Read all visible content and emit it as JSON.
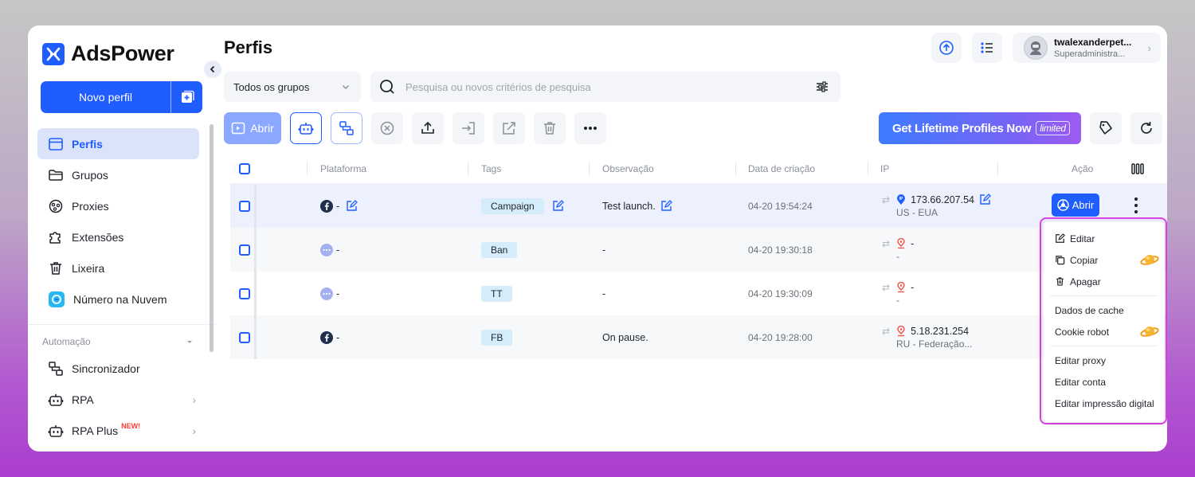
{
  "brand": {
    "name": "AdsPower",
    "color": "#1f5dff"
  },
  "sidebar": {
    "new_profile_label": "Novo perfil",
    "items": [
      {
        "label": "Perfis",
        "icon": "browser-window-icon",
        "active": true
      },
      {
        "label": "Grupos",
        "icon": "folder-icon",
        "active": false
      },
      {
        "label": "Proxies",
        "icon": "network-icon",
        "active": false
      },
      {
        "label": "Extensões",
        "icon": "puzzle-icon",
        "active": false
      },
      {
        "label": "Lixeira",
        "icon": "trash-icon",
        "active": false
      },
      {
        "label": "Número na Nuvem",
        "icon": "cloud-number-icon",
        "active": false
      }
    ],
    "automation_header": "Automação",
    "automation_items": [
      {
        "label": "Sincronizador",
        "icon": "sync-icon"
      },
      {
        "label": "RPA",
        "icon": "robot-icon"
      },
      {
        "label": "RPA Plus",
        "icon": "robot-icon",
        "badge": "NEW!"
      }
    ]
  },
  "header": {
    "title": "Perfis",
    "user": {
      "name": "twalexanderpet...",
      "role": "Superadministra..."
    }
  },
  "filters": {
    "group_select": "Todos os grupos",
    "search_placeholder": "Pesquisa ou novos critérios de pesquisa"
  },
  "toolbar": {
    "open_label": "Abrir",
    "promo_text": "Get Lifetime Profiles Now",
    "promo_tag": "limited"
  },
  "table": {
    "columns": {
      "platform": "Plataforma",
      "tags": "Tags",
      "note": "Observação",
      "created": "Data de criação",
      "ip": "IP",
      "action": "Ação"
    },
    "open_button": "Abrir",
    "rows": [
      {
        "platform_icon": "facebook-icon",
        "platform": "-",
        "tag": "Campaign",
        "note": "Test launch.",
        "created": "04-20 19:54:24",
        "ip": "173.66.207.54",
        "ip_location": "US - EUA",
        "selected": true
      },
      {
        "platform_icon": "generic-platform-icon",
        "platform": "-",
        "tag": "Ban",
        "note": "-",
        "created": "04-20 19:30:18",
        "ip": "-",
        "ip_location": "-"
      },
      {
        "platform_icon": "generic-platform-icon",
        "platform": "-",
        "tag": "TT",
        "note": "-",
        "created": "04-20 19:30:09",
        "ip": "-",
        "ip_location": "-"
      },
      {
        "platform_icon": "facebook-icon",
        "platform": "-",
        "tag": "FB",
        "note": "On pause.",
        "created": "04-20 19:28:00",
        "ip": "5.18.231.254",
        "ip_location": "RU - Federação..."
      }
    ]
  },
  "context_menu": {
    "items": [
      "Editar",
      "Copiar",
      "Apagar",
      "Dados de cache",
      "Cookie robot",
      "Editar proxy",
      "Editar conta",
      "Editar impressão digital"
    ]
  },
  "colors": {
    "accent": "#1f5dff",
    "highlight_outline": "#e040e8",
    "tag_bg": "#d5ecfb"
  }
}
